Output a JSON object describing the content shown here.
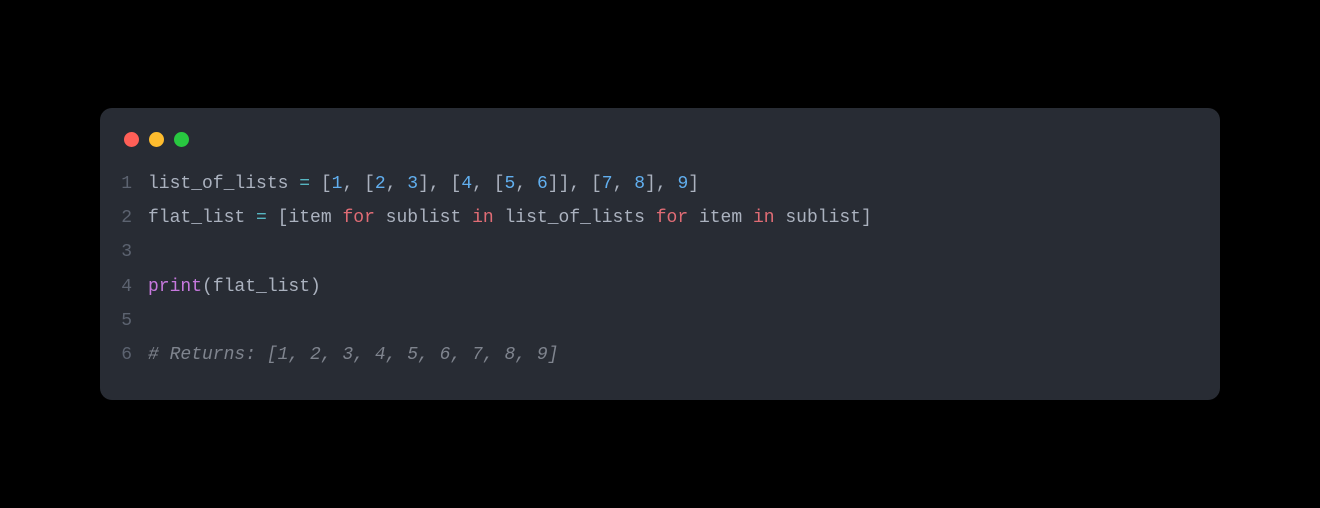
{
  "window": {
    "controls": [
      "close",
      "minimize",
      "zoom"
    ]
  },
  "code": {
    "lines": [
      {
        "num": "1",
        "tokens": [
          {
            "t": "list_of_lists ",
            "c": "tk-default"
          },
          {
            "t": "=",
            "c": "tk-operator"
          },
          {
            "t": " [",
            "c": "tk-punct"
          },
          {
            "t": "1",
            "c": "tk-number"
          },
          {
            "t": ", [",
            "c": "tk-punct"
          },
          {
            "t": "2",
            "c": "tk-number"
          },
          {
            "t": ", ",
            "c": "tk-punct"
          },
          {
            "t": "3",
            "c": "tk-number"
          },
          {
            "t": "], [",
            "c": "tk-punct"
          },
          {
            "t": "4",
            "c": "tk-number"
          },
          {
            "t": ", [",
            "c": "tk-punct"
          },
          {
            "t": "5",
            "c": "tk-number"
          },
          {
            "t": ", ",
            "c": "tk-punct"
          },
          {
            "t": "6",
            "c": "tk-number"
          },
          {
            "t": "]], [",
            "c": "tk-punct"
          },
          {
            "t": "7",
            "c": "tk-number"
          },
          {
            "t": ", ",
            "c": "tk-punct"
          },
          {
            "t": "8",
            "c": "tk-number"
          },
          {
            "t": "], ",
            "c": "tk-punct"
          },
          {
            "t": "9",
            "c": "tk-number"
          },
          {
            "t": "]",
            "c": "tk-punct"
          }
        ]
      },
      {
        "num": "2",
        "tokens": [
          {
            "t": "flat_list ",
            "c": "tk-default"
          },
          {
            "t": "=",
            "c": "tk-operator"
          },
          {
            "t": " [item ",
            "c": "tk-default"
          },
          {
            "t": "for",
            "c": "tk-keyword"
          },
          {
            "t": " sublist ",
            "c": "tk-default"
          },
          {
            "t": "in",
            "c": "tk-keyword"
          },
          {
            "t": " list_of_lists ",
            "c": "tk-default"
          },
          {
            "t": "for",
            "c": "tk-keyword"
          },
          {
            "t": " item ",
            "c": "tk-default"
          },
          {
            "t": "in",
            "c": "tk-keyword"
          },
          {
            "t": " sublist]",
            "c": "tk-default"
          }
        ]
      },
      {
        "num": "3",
        "tokens": []
      },
      {
        "num": "4",
        "tokens": [
          {
            "t": "print",
            "c": "tk-func"
          },
          {
            "t": "(flat_list)",
            "c": "tk-default"
          }
        ]
      },
      {
        "num": "5",
        "tokens": []
      },
      {
        "num": "6",
        "tokens": [
          {
            "t": "# Returns: [1, 2, 3, 4, 5, 6, 7, 8, 9]",
            "c": "tk-comment"
          }
        ]
      }
    ]
  }
}
